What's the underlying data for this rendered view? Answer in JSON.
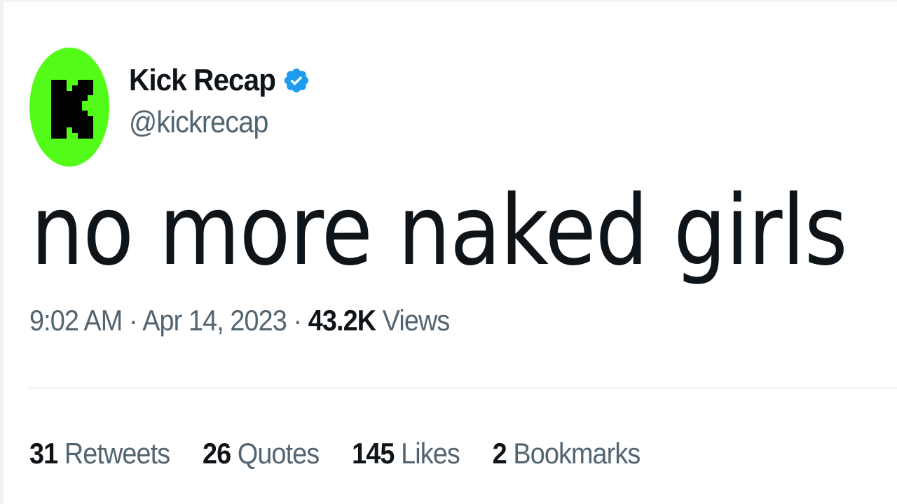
{
  "author": {
    "display_name": "Kick Recap",
    "handle": "@kickrecap",
    "verified_icon": "verified-badge-icon",
    "avatar_icon": "kick-logo-icon",
    "avatar_color": "#53fc18"
  },
  "tweet": {
    "text": "no more naked girls",
    "time": "9:02 AM",
    "date": "Apr 14, 2023",
    "views_count": "43.2K",
    "views_label": "Views",
    "separator": "·"
  },
  "stats": {
    "retweets_count": "31",
    "retweets_label": "Retweets",
    "quotes_count": "26",
    "quotes_label": "Quotes",
    "likes_count": "145",
    "likes_label": "Likes",
    "bookmarks_count": "2",
    "bookmarks_label": "Bookmarks"
  },
  "colors": {
    "text_primary": "#0f1419",
    "text_secondary": "#536471",
    "verified_blue": "#1d9bf0",
    "divider": "#eff3f4"
  }
}
